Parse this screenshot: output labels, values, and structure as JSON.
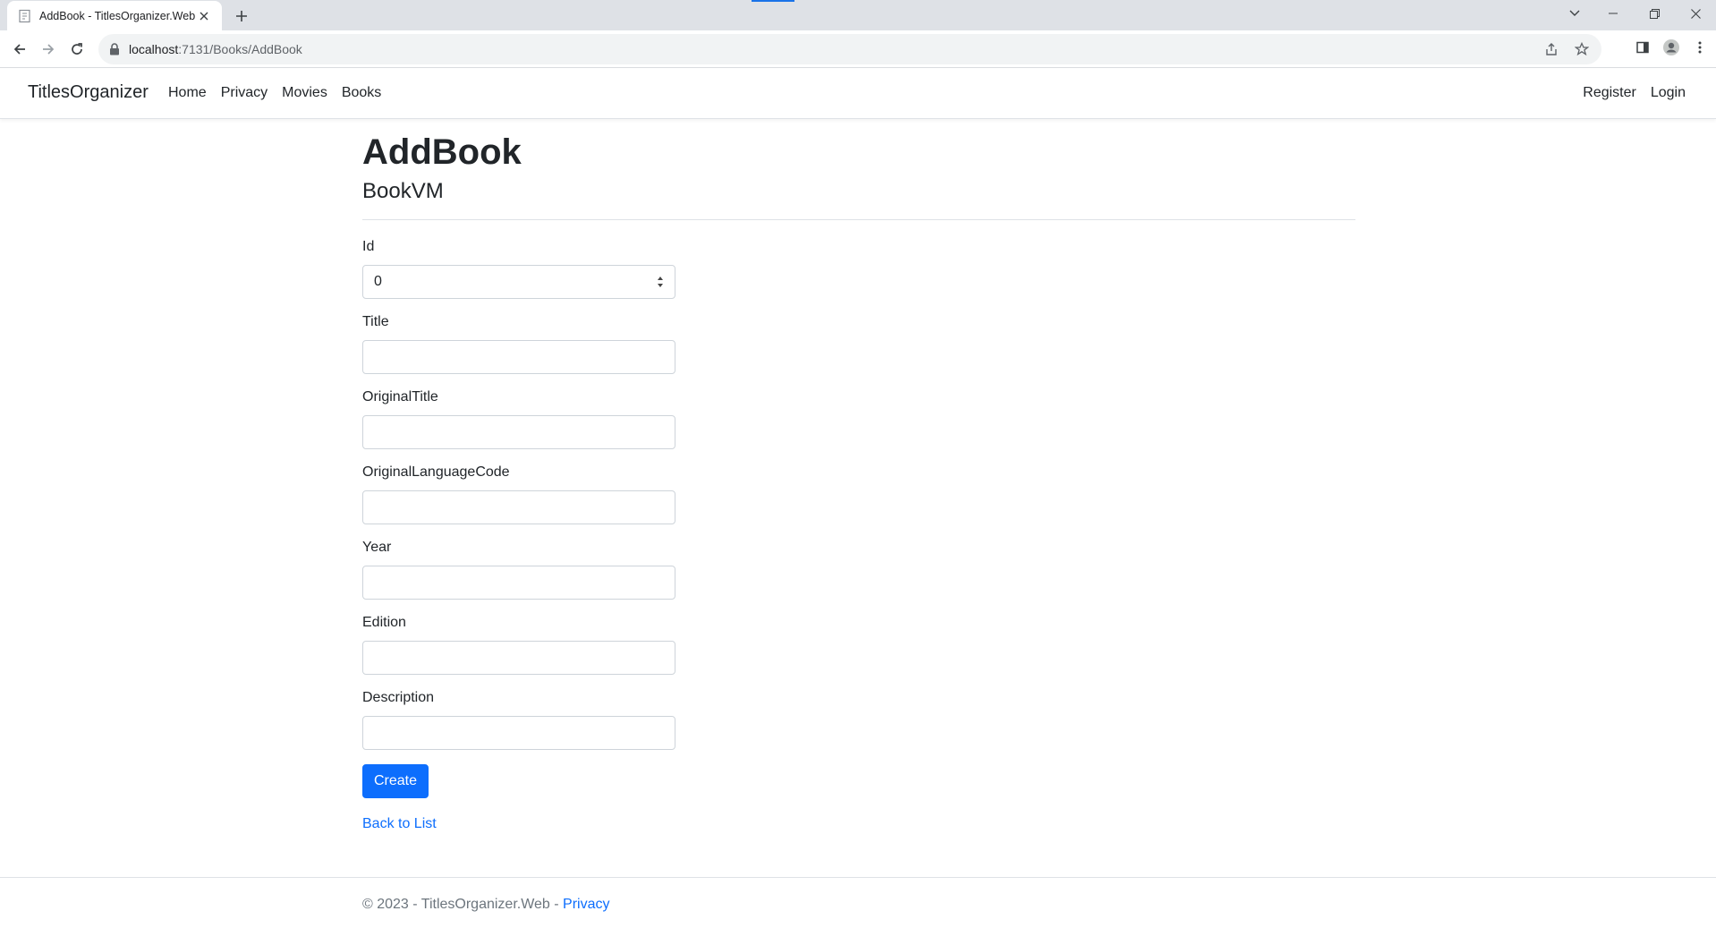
{
  "browser": {
    "tab_title": "AddBook - TitlesOrganizer.Web",
    "url_host": "localhost",
    "url_path": ":7131/Books/AddBook"
  },
  "navbar": {
    "brand": "TitlesOrganizer",
    "links": [
      "Home",
      "Privacy",
      "Movies",
      "Books"
    ],
    "right_links": [
      "Register",
      "Login"
    ]
  },
  "page": {
    "title": "AddBook",
    "subtitle": "BookVM"
  },
  "form": {
    "fields": [
      {
        "label": "Id",
        "value": "0"
      },
      {
        "label": "Title",
        "value": ""
      },
      {
        "label": "OriginalTitle",
        "value": ""
      },
      {
        "label": "OriginalLanguageCode",
        "value": ""
      },
      {
        "label": "Year",
        "value": ""
      },
      {
        "label": "Edition",
        "value": ""
      },
      {
        "label": "Description",
        "value": ""
      }
    ],
    "submit_label": "Create",
    "back_label": "Back to List"
  },
  "footer": {
    "text": "© 2023 - TitlesOrganizer.Web - ",
    "link": "Privacy"
  },
  "colors": {
    "accent": "#0d6efd",
    "chrome_tabstrip": "#dee1e6",
    "omnibox": "#f1f3f4"
  }
}
